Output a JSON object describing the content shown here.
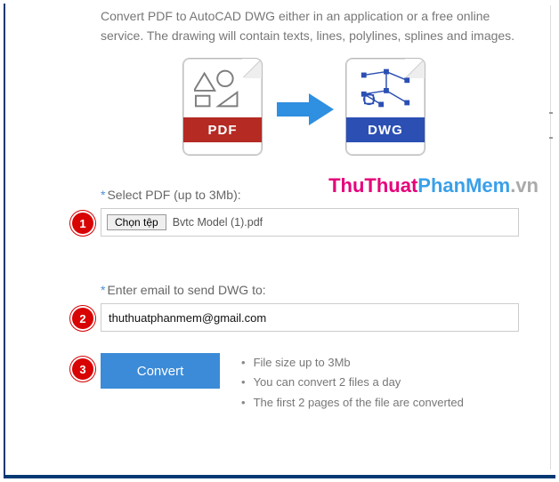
{
  "intro": "Convert PDF to AutoCAD DWG either in an application or a free online service. The drawing will contain texts, lines, polylines, splines and images.",
  "illustration": {
    "from_badge": "PDF",
    "to_badge": "DWG"
  },
  "watermark": {
    "part1": "ThuThuat",
    "part2": "PhanMem",
    "part3": ".vn"
  },
  "step1": {
    "num": "1",
    "label": "Select PDF (up to 3Mb):",
    "button": "Chọn tệp",
    "filename": "Bvtc Model (1).pdf"
  },
  "step2": {
    "num": "2",
    "label": "Enter email to send DWG to:",
    "value": "thuthuatphanmem@gmail.com"
  },
  "step3": {
    "num": "3",
    "convert": "Convert",
    "notes": [
      "File size up to 3Mb",
      "You can convert 2 files a day",
      "The first 2 pages of the file are converted"
    ]
  }
}
